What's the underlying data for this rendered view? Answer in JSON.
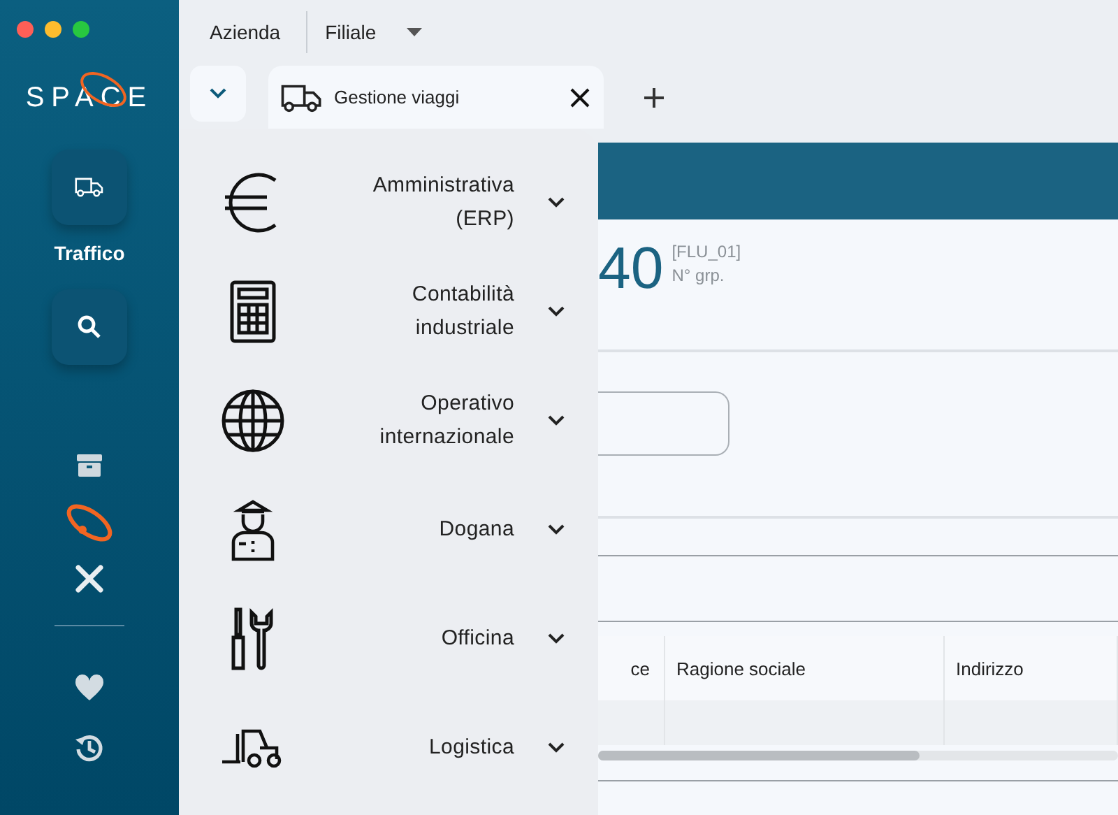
{
  "window": {
    "controls": [
      {
        "color": "#fe5f57"
      },
      {
        "color": "#fdbc2e"
      },
      {
        "color": "#28c840"
      }
    ]
  },
  "sidebar": {
    "logo": "SPACE",
    "tile_label": "Traffico"
  },
  "top_bar": {
    "company": "Azienda",
    "branch": "Filiale"
  },
  "tabs": [
    {
      "label": "Gestione viaggi",
      "selected": true
    }
  ],
  "module_menu": [
    {
      "label": "Amministrativa (ERP)",
      "expanded": false
    },
    {
      "label": "Contabilità industriale",
      "expanded": false
    },
    {
      "label": "Operativo internazionale",
      "expanded": false
    },
    {
      "label": "Dogana",
      "expanded": false
    },
    {
      "label": "Officina",
      "expanded": false
    },
    {
      "label": "Logistica",
      "expanded": false
    }
  ],
  "content": {
    "number": "40",
    "code": "[FLU_01]",
    "code_label": "N° grp.",
    "table": {
      "columns": [
        "ce",
        "Ragione sociale",
        "Indirizzo"
      ]
    }
  }
}
